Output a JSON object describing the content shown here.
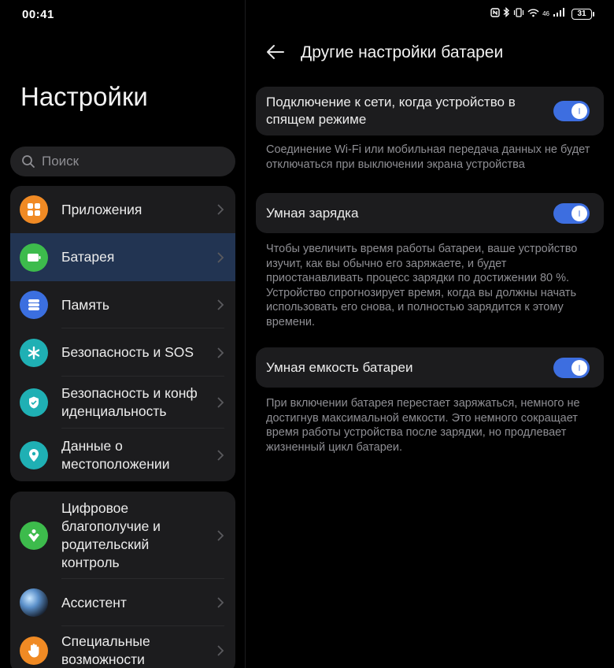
{
  "status": {
    "time": "00:41",
    "network": "46",
    "battery": "31"
  },
  "left": {
    "title": "Настройки",
    "search_placeholder": "Поиск",
    "items": [
      {
        "label": "Приложения",
        "icon": "apps-icon",
        "color": "#f08a24"
      },
      {
        "label": "Батарея",
        "icon": "battery-icon",
        "color": "#3dbb4c",
        "selected": true
      },
      {
        "label": "Память",
        "icon": "storage-icon",
        "color": "#3b6fe0"
      },
      {
        "label": "Безопасность и SOS",
        "icon": "asterisk-icon",
        "color": "#1fb0b4"
      },
      {
        "label": "Безопасность и конфиденциальность",
        "icon": "shield-icon",
        "color": "#1fb0b4"
      },
      {
        "label": "Данные о местоположении",
        "icon": "location-icon",
        "color": "#1fb0b4"
      }
    ],
    "items2": [
      {
        "label": "Цифровое благополучие и родительский контроль",
        "icon": "wellbeing-icon",
        "color": "#3dbb4c"
      },
      {
        "label": "Ассистент",
        "icon": "assistant-icon",
        "color": "#2a3b5c"
      },
      {
        "label": "Специальные возможности",
        "icon": "hand-icon",
        "color": "#f08a24"
      }
    ]
  },
  "right": {
    "title": "Другие настройки батареи",
    "settings": [
      {
        "label": "Подключение к сети, когда устройство в спящем режиме",
        "enabled": true,
        "description": "Соединение Wi-Fi или мобильная передача данных не будет отключаться при выключении экрана устройства"
      },
      {
        "label": "Умная зарядка",
        "enabled": true,
        "description": "Чтобы увеличить время работы батареи, ваше устройство изучит, как вы обычно его заряжаете, и будет приостанавливать процесс зарядки по достижении 80 %. Устройство спрогнозирует время, когда вы должны начать использовать его снова, и полностью зарядится к этому времени."
      },
      {
        "label": "Умная емкость батареи",
        "enabled": true,
        "description": "При включении батарея перестает заряжаться, немного не достигнув максимальной емкости. Это немного сокращает время работы устройства после зарядки, но продлевает жизненный цикл батареи."
      }
    ]
  },
  "colors": {
    "accent": "#3d6ee0",
    "selected_bg": "#223452",
    "card_bg": "#1c1c1e"
  }
}
